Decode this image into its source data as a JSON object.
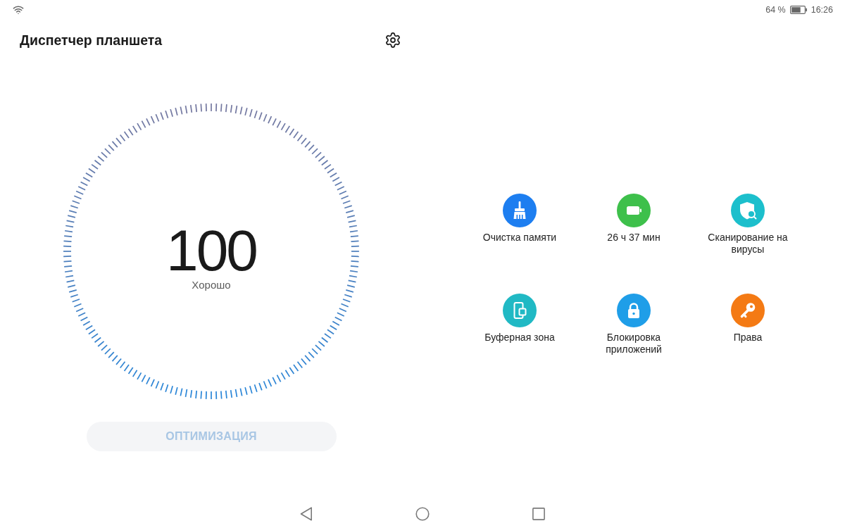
{
  "status_bar": {
    "battery_percent": "64 %",
    "time": "16:26"
  },
  "header": {
    "title": "Диспетчер планшета"
  },
  "score": {
    "value": "100",
    "rating": "Хорошо"
  },
  "optimize_button": {
    "label": "ОПТИМИЗАЦИЯ",
    "disabled": true
  },
  "tools": [
    {
      "label": "Очистка памяти",
      "color": "#1d7ef0"
    },
    {
      "label": "26 ч 37 мин",
      "color": "#3ec04b"
    },
    {
      "label": "Сканирование на вирусы",
      "color": "#1cbfcc"
    },
    {
      "label": "Буферная зона",
      "color": "#20b9c4"
    },
    {
      "label": "Блокировка приложений",
      "color": "#1f9ee8"
    },
    {
      "label": "Права",
      "color": "#f47a14"
    }
  ]
}
